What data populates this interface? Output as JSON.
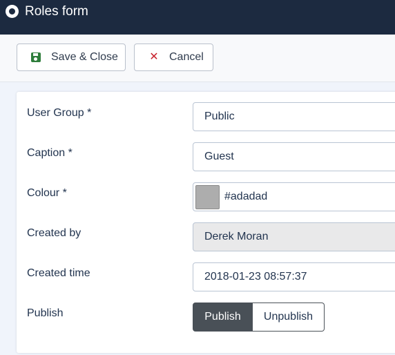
{
  "header": {
    "title": "Roles form",
    "icon": "circle-dot-icon"
  },
  "toolbar": {
    "save_label": "Save & Close",
    "cancel_label": "Cancel"
  },
  "form": {
    "user_group": {
      "label": "User Group *",
      "value": "Public"
    },
    "caption": {
      "label": "Caption *",
      "value": "Guest"
    },
    "colour": {
      "label": "Colour *",
      "value": "#adadad",
      "swatch": "#adadad"
    },
    "created_by": {
      "label": "Created by",
      "value": "Derek Moran"
    },
    "created_time": {
      "label": "Created time",
      "value": "2018-01-23 08:57:37"
    },
    "publish": {
      "label": "Publish",
      "on_label": "Publish",
      "off_label": "Unpublish",
      "selected": "Publish"
    }
  },
  "colors": {
    "header_bg": "#1c2a40",
    "save_icon": "#2e7d3b",
    "cancel_icon": "#c8222d",
    "toggle_active": "#495057"
  }
}
